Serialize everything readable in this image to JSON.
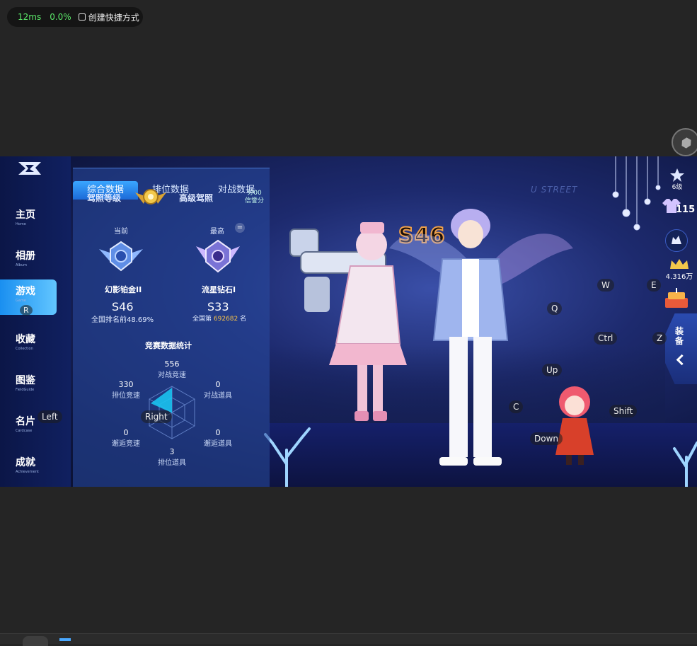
{
  "statusbar": {
    "latency": "12ms",
    "loss": "0.0%",
    "shortcut": "创建快捷方式"
  },
  "nav": {
    "items": [
      {
        "zh": "主页",
        "en": "Home"
      },
      {
        "zh": "相册",
        "en": "Album"
      },
      {
        "zh": "游戏",
        "en": "Game"
      },
      {
        "zh": "收藏",
        "en": "Collection"
      },
      {
        "zh": "图鉴",
        "en": "FieldGuide"
      },
      {
        "zh": "名片",
        "en": "Cardcase"
      },
      {
        "zh": "成就",
        "en": "Achievement"
      }
    ]
  },
  "panel": {
    "tabs": [
      "综合数据",
      "排位数据",
      "对战数据"
    ],
    "license_label": "驾照等级",
    "license_value": "高级驾照",
    "credit_value": "分00",
    "credit_label": "信誉分",
    "current_label": "当前",
    "highest_label": "最高",
    "current_rank": "幻影铂金II",
    "highest_rank": "流星钻石I",
    "current_season": "S46",
    "highest_season": "S33",
    "current_rank_text": "全国排名前48.69%",
    "highest_rank_prefix": "全国第",
    "highest_rank_number": "692682",
    "highest_rank_suffix": "名",
    "stats_title": "竞赛数据统计",
    "stats": [
      {
        "value": "556",
        "label": "对战竞速"
      },
      {
        "value": "0",
        "label": "对战道具"
      },
      {
        "value": "0",
        "label": "邂逅道具"
      },
      {
        "value": "3",
        "label": "排位道具"
      },
      {
        "value": "0",
        "label": "邂逅竞速"
      },
      {
        "value": "330",
        "label": "排位竞速"
      }
    ]
  },
  "scene": {
    "season_badge": "S46",
    "watermark": "U STREET"
  },
  "right": {
    "level": "6级",
    "outfits": "115",
    "coins": "4.316万",
    "equip_label": "装备"
  },
  "keys": {
    "r": "R",
    "left": "Left",
    "right": "Right",
    "w": "W",
    "e": "E",
    "q": "Q",
    "ctrl": "Ctrl",
    "z": "Z",
    "up": "Up",
    "c": "C",
    "shift": "Shift",
    "down": "Down"
  },
  "colors": {
    "accent": "#2e8ff0",
    "rank_highlight": "#f4c04a",
    "radar_fill": "#19c2ef"
  }
}
